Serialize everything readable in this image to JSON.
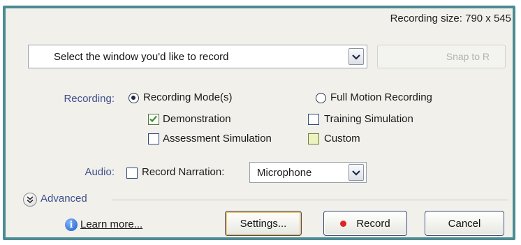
{
  "header": {
    "recording_size": "Recording size: 790 x 545"
  },
  "window_select": {
    "value": "Select the window you'd like to record",
    "icon": "chevron-down-icon"
  },
  "snap_button": {
    "label": "Snap to R"
  },
  "recording": {
    "label": "Recording:",
    "mode_options": [
      {
        "label": "Recording Mode(s)",
        "selected": true
      },
      {
        "label": "Full Motion Recording",
        "selected": false
      }
    ],
    "checkboxes": [
      {
        "label": "Demonstration",
        "checked": true
      },
      {
        "label": "Training Simulation",
        "checked": false
      },
      {
        "label": "Assessment Simulation",
        "checked": false
      },
      {
        "label": "Custom",
        "checked": false
      }
    ]
  },
  "audio": {
    "label": "Audio:",
    "narration_label": "Record Narration:",
    "narration_checked": false,
    "source": "Microphone"
  },
  "advanced": {
    "label": "Advanced",
    "icon": "double-chevron-down-icon"
  },
  "footer": {
    "learn_more": "Learn more...",
    "info_icon": "info-icon",
    "settings": "Settings...",
    "record": "Record",
    "cancel": "Cancel"
  },
  "colors": {
    "frame": "#4c8b93",
    "panel": "#f1f0ea",
    "label_blue": "#3f4f8e",
    "record_red": "#e02222",
    "focus_orange": "#f2c46f"
  }
}
